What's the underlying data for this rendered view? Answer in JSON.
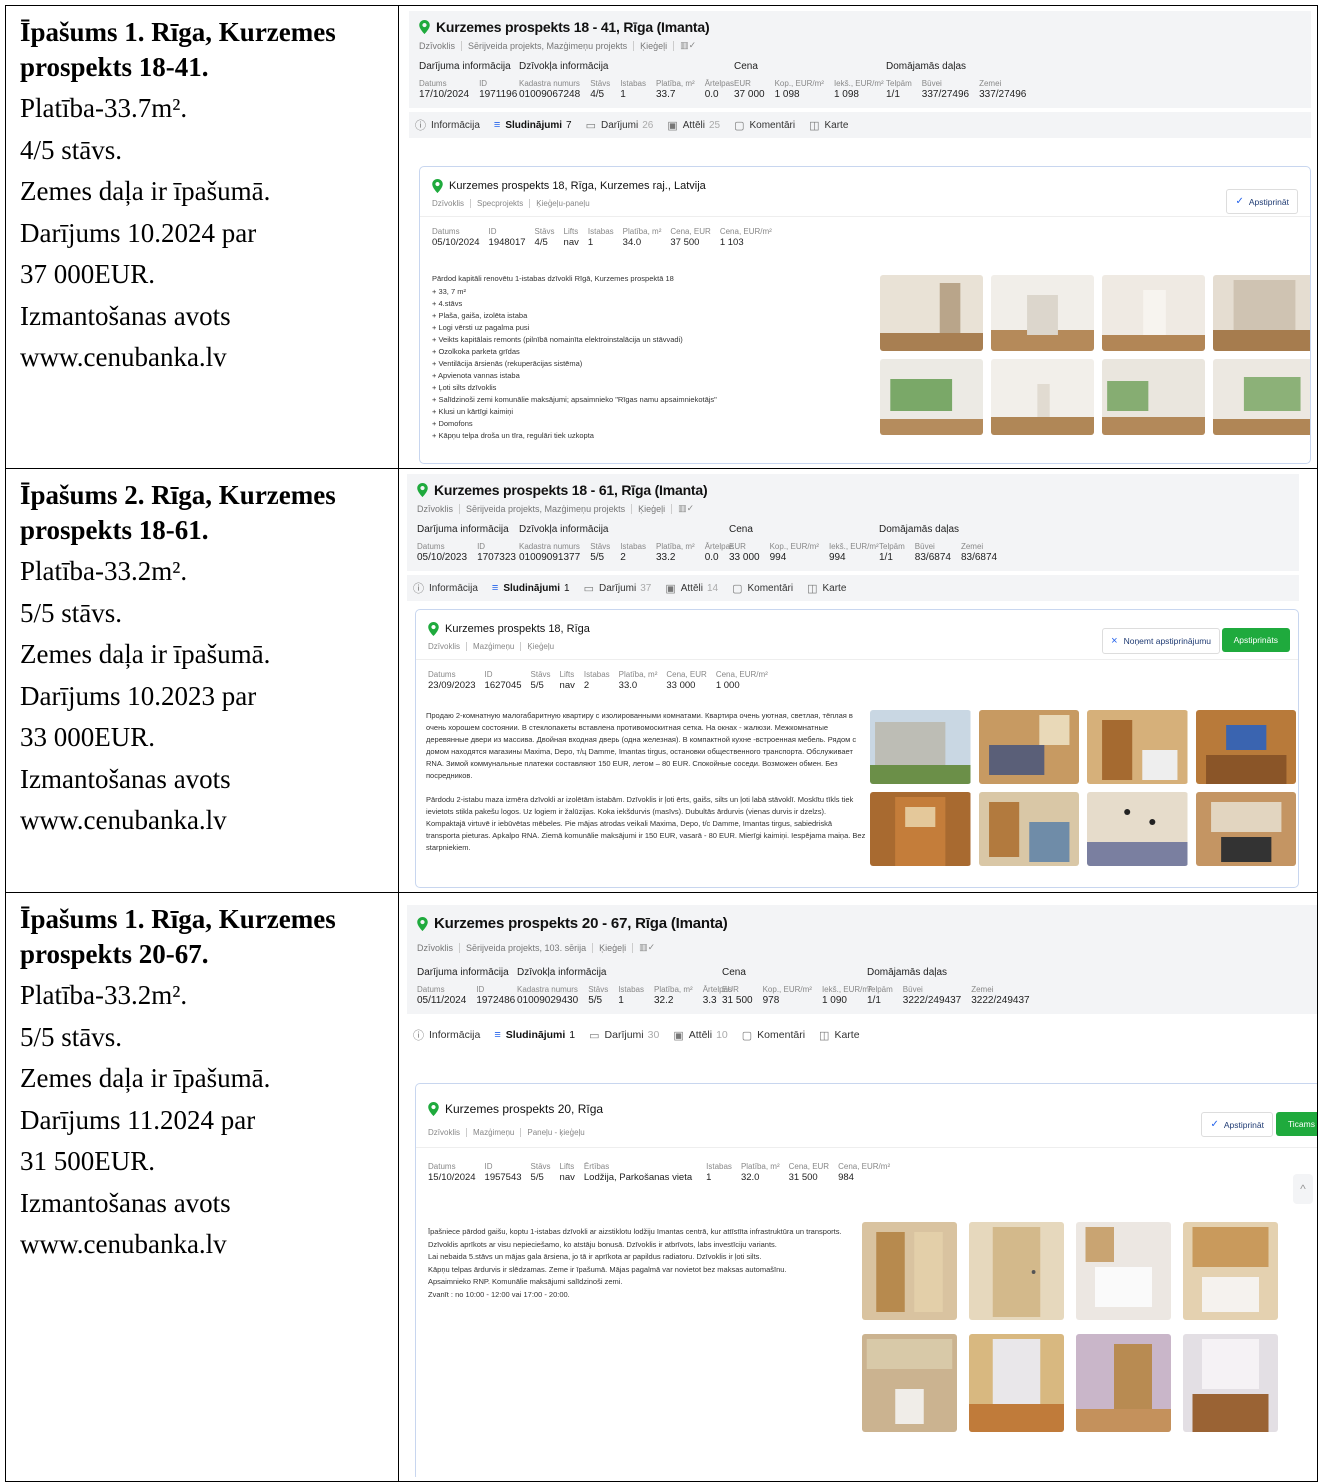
{
  "rows": [
    {
      "left": {
        "title": "Īpašums 1. Rīga, Kurzemes prospekts 18-41.",
        "title_line1": "Īpašums 1. Rīga, Kurzemes",
        "title_line2": "prospekts 18-41.",
        "area": "Platība-33.7m².",
        "floor": "4/5 stāvs.",
        "land": "Zemes daļa ir īpašumā.",
        "deal_line1": "Darījums 10.2024 par",
        "deal_line2": "37 000EUR.",
        "source_line1": "Izmantošanas avots",
        "source_line2": "www.cenubanka.lv"
      },
      "shot": {
        "address": "Kurzemes prospekts 18 - 41, Rīga (Imanta)",
        "tags": [
          "Dzīvoklis",
          "Sērijveida projekts, Mazģimeņu projekts",
          "Ķieģeļi",
          "▥✓"
        ],
        "groups": [
          {
            "title": "Darījuma informācija",
            "fields": [
              {
                "k": "Datums",
                "v": "17/10/2024"
              },
              {
                "k": "ID",
                "v": "1971196"
              }
            ]
          },
          {
            "title": "Dzīvokļa informācija",
            "fields": [
              {
                "k": "Kadastra numurs",
                "v": "01009067248"
              },
              {
                "k": "Stāvs",
                "v": "4/5"
              },
              {
                "k": "Istabas",
                "v": "1"
              },
              {
                "k": "Platība, m²",
                "v": "33.7"
              },
              {
                "k": "Ārtelpas",
                "v": "0.0"
              }
            ]
          },
          {
            "title": "Cena",
            "fields": [
              {
                "k": "EUR",
                "v": "37 000"
              },
              {
                "k": "Kop., EUR/m²",
                "v": "1 098"
              },
              {
                "k": "Iekš., EUR/m²",
                "v": "1 098"
              }
            ]
          },
          {
            "title": "Domājamās daļas",
            "fields": [
              {
                "k": "Telpām",
                "v": "1/1"
              },
              {
                "k": "Būvei",
                "v": "337/27496"
              },
              {
                "k": "Zemei",
                "v": "337/27496"
              }
            ]
          }
        ],
        "tabs": [
          {
            "icon": "ⓘ",
            "label": "Informācija",
            "count": ""
          },
          {
            "icon": "≡",
            "label": "Sludinājumi",
            "count": "7"
          },
          {
            "icon": "▭",
            "label": "Darījumi",
            "count": "26"
          },
          {
            "icon": "▣",
            "label": "Attēli",
            "count": "25"
          },
          {
            "icon": "▢",
            "label": "Komentāri",
            "count": ""
          },
          {
            "icon": "◫",
            "label": "Karte",
            "count": ""
          }
        ],
        "card": {
          "address": "Kurzemes prospekts 18, Rīga, Kurzemes raj., Latvija",
          "tags": [
            "Dzīvoklis",
            "Specprojekts",
            "Ķieģeļu-paneļu"
          ],
          "fields": [
            {
              "k": "Datums",
              "v": "05/10/2024"
            },
            {
              "k": "ID",
              "v": "1948017"
            },
            {
              "k": "Stāvs",
              "v": "4/5"
            },
            {
              "k": "Lifts",
              "v": "nav"
            },
            {
              "k": "Istabas",
              "v": "1"
            },
            {
              "k": "Platība, m²",
              "v": "34.0"
            },
            {
              "k": "Cena, EUR",
              "v": "37 500"
            },
            {
              "k": "Cena, EUR/m²",
              "v": "1 103"
            }
          ],
          "confirm": "Apstiprināt",
          "desc": [
            "Pārdod kapitāli renovētu 1-istabas dzīvokli Rīgā, Kurzemes prospektā 18",
            "+ 33, 7 m²",
            "+ 4.stāvs",
            "+ Plaša, gaiša, izolēta istaba",
            "+ Logi vērsti uz pagalma pusi",
            "+ Veikts kapitālais remonts (pilnībā nomainīta elektroinstalācija un stāvvadi)",
            "+ Ozolkoka parketa grīdas",
            "+ Ventilācija ārsienās (rekuperācijas sistēma)",
            "+ Apvienota vannas istaba",
            "+ Ļoti silts dzīvoklis",
            "+ Salīdzinoši zemi komunālie maksājumi; apsaimnieko \"Rīgas namu apsaimniekotājs\"",
            "+ Klusi un kārtīgi kaimiņi",
            "+ Domofons",
            "+ Kāpņu telpa droša un tīra, regulāri tiek uzkopta"
          ]
        }
      }
    },
    {
      "left": {
        "title_line1": "Īpašums 2. Rīga, Kurzemes",
        "title_line2": "prospekts 18-61.",
        "area": "Platība-33.2m².",
        "floor": "5/5 stāvs.",
        "land": "Zemes daļa ir īpašumā.",
        "deal_line1": "Darījums 10.2023 par",
        "deal_line2": "33 000EUR.",
        "source_line1": "Izmantošanas avots",
        "source_line2": "www.cenubanka.lv"
      },
      "shot": {
        "address": "Kurzemes prospekts 18 - 61, Rīga (Imanta)",
        "tags": [
          "Dzīvoklis",
          "Sērijveida projekts, Mazģimeņu projekts",
          "Ķieģeļi",
          "▥✓"
        ],
        "groups": [
          {
            "title": "Darījuma informācija",
            "fields": [
              {
                "k": "Datums",
                "v": "05/10/2023"
              },
              {
                "k": "ID",
                "v": "1707323"
              }
            ]
          },
          {
            "title": "Dzīvokļa informācija",
            "fields": [
              {
                "k": "Kadastra numurs",
                "v": "01009091377"
              },
              {
                "k": "Stāvs",
                "v": "5/5"
              },
              {
                "k": "Istabas",
                "v": "2"
              },
              {
                "k": "Platība, m²",
                "v": "33.2"
              },
              {
                "k": "Ārtelpas",
                "v": "0.0"
              }
            ]
          },
          {
            "title": "Cena",
            "fields": [
              {
                "k": "EUR",
                "v": "33 000"
              },
              {
                "k": "Kop., EUR/m²",
                "v": "994"
              },
              {
                "k": "Iekš., EUR/m²",
                "v": "994"
              }
            ]
          },
          {
            "title": "Domājamās daļas",
            "fields": [
              {
                "k": "Telpām",
                "v": "1/1"
              },
              {
                "k": "Būvei",
                "v": "83/6874"
              },
              {
                "k": "Zemei",
                "v": "83/6874"
              }
            ]
          }
        ],
        "tabs": [
          {
            "icon": "ⓘ",
            "label": "Informācija",
            "count": ""
          },
          {
            "icon": "≡",
            "label": "Sludinājumi",
            "count": "1"
          },
          {
            "icon": "▭",
            "label": "Darījumi",
            "count": "37"
          },
          {
            "icon": "▣",
            "label": "Attēli",
            "count": "14"
          },
          {
            "icon": "▢",
            "label": "Komentāri",
            "count": ""
          },
          {
            "icon": "◫",
            "label": "Karte",
            "count": ""
          }
        ],
        "card": {
          "address": "Kurzemes prospekts 18, Rīga",
          "tags": [
            "Dzīvoklis",
            "Mazģimeņu",
            "Ķieģeļu"
          ],
          "fields": [
            {
              "k": "Datums",
              "v": "23/09/2023"
            },
            {
              "k": "ID",
              "v": "1627045"
            },
            {
              "k": "Stāvs",
              "v": "5/5"
            },
            {
              "k": "Lifts",
              "v": "nav"
            },
            {
              "k": "Istabas",
              "v": "2"
            },
            {
              "k": "Platība, m²",
              "v": "33.0"
            },
            {
              "k": "Cena, EUR",
              "v": "33 000"
            },
            {
              "k": "Cena, EUR/m²",
              "v": "1 000"
            }
          ],
          "unconfirm": "Noņemt apstiprinājumu",
          "confirmed": "Apstiprināts",
          "desc_p1": "Продаю 2-комнатную малогабаритную квартиру с изолированными комнатами. Квартира очень уютная, светлая, тёплая в очень хорошем состоянии. В стеклопакеты вставлена противомоскитная сетка. На окнах - жалюзи. Межкомнатные деревянные двери из массива. Двойная входная дверь (одна железная). В компактной кухне -встроенная мебель. Рядом с домом находятся магазины Maxima, Depo, т/ц Damme, Imantas tirgus, остановки общественного транспорта. Обслуживает RNA. Зимой коммунальные платежи составляют 150 EUR, летом – 80 EUR. Спокойные соседи. Возможен обмен. Без посредников.",
          "desc_p2": "Pārdodu 2-istabu maza izmēra dzīvokli ar izolētām istabām. Dzīvoklis ir ļoti ērts, gaišs, silts un ļoti labā stāvoklī. Moskītu tīkls tiek ievietots stikla pakešu logos. Uz logiem ir žalūzijas. Koka iekšdurvis (masīvs). Dubultās ārdurvis (vienas durvis ir dzelzs). Kompaktajā virtuvē ir iebūvētas mēbeles. Pie mājas atrodas veikali Maxima, Depo, t/c Damme, Imantas tirgus, sabiedriskā transporta pieturas. Apkalpo RNA. Ziemā komunālie maksājumi ir 150 EUR, vasarā - 80 EUR. Mierīgi kaimiņi. Iespējama maiņa. Bez starpniekiem."
        }
      }
    },
    {
      "left": {
        "title_line1": "Īpašums 1. Rīga, Kurzemes",
        "title_line2": "prospekts 20-67.",
        "area": "Platība-33.2m².",
        "floor": "5/5 stāvs.",
        "land": "Zemes daļa ir īpašumā.",
        "deal_line1": "Darījums 11.2024 par",
        "deal_line2": "31 500EUR.",
        "source_line1": "Izmantošanas avots",
        "source_line2": "www.cenubanka.lv"
      },
      "shot": {
        "address": "Kurzemes prospekts 20 - 67, Rīga (Imanta)",
        "tags": [
          "Dzīvoklis",
          "Sērijveida projekts, 103. sērija",
          "Ķieģeļi",
          "▥✓"
        ],
        "groups": [
          {
            "title": "Darījuma informācija",
            "fields": [
              {
                "k": "Datums",
                "v": "05/11/2024"
              },
              {
                "k": "ID",
                "v": "1972486"
              }
            ]
          },
          {
            "title": "Dzīvokļa informācija",
            "fields": [
              {
                "k": "Kadastra numurs",
                "v": "01009029430"
              },
              {
                "k": "Stāvs",
                "v": "5/5"
              },
              {
                "k": "Istabas",
                "v": "1"
              },
              {
                "k": "Platība, m²",
                "v": "32.2"
              },
              {
                "k": "Ārtelpas",
                "v": "3.3"
              }
            ]
          },
          {
            "title": "Cena",
            "fields": [
              {
                "k": "EUR",
                "v": "31 500"
              },
              {
                "k": "Kop., EUR/m²",
                "v": "978"
              },
              {
                "k": "Iekš., EUR/m²",
                "v": "1 090"
              }
            ]
          },
          {
            "title": "Domājamās daļas",
            "fields": [
              {
                "k": "Telpām",
                "v": "1/1"
              },
              {
                "k": "Būvei",
                "v": "3222/249437"
              },
              {
                "k": "Zemei",
                "v": "3222/249437"
              }
            ]
          }
        ],
        "tabs": [
          {
            "icon": "ⓘ",
            "label": "Informācija",
            "count": ""
          },
          {
            "icon": "≡",
            "label": "Sludinājumi",
            "count": "1"
          },
          {
            "icon": "▭",
            "label": "Darījumi",
            "count": "30"
          },
          {
            "icon": "▣",
            "label": "Attēli",
            "count": "10"
          },
          {
            "icon": "▢",
            "label": "Komentāri",
            "count": ""
          },
          {
            "icon": "◫",
            "label": "Karte",
            "count": ""
          }
        ],
        "card": {
          "address": "Kurzemes prospekts 20, Rīga",
          "tags": [
            "Dzīvoklis",
            "Mazģimeņu",
            "Paneļu - ķieģeļu"
          ],
          "fields": [
            {
              "k": "Datums",
              "v": "15/10/2024"
            },
            {
              "k": "ID",
              "v": "1957543"
            },
            {
              "k": "Stāvs",
              "v": "5/5"
            },
            {
              "k": "Lifts",
              "v": "nav"
            },
            {
              "k": "Ērtības",
              "v": "Lodžija, Parkošanas vieta"
            },
            {
              "k": "Istabas",
              "v": "1"
            },
            {
              "k": "Platība, m²",
              "v": "32.0"
            },
            {
              "k": "Cena, EUR",
              "v": "31 500"
            },
            {
              "k": "Cena, EUR/m²",
              "v": "984"
            }
          ],
          "confirm": "Apstiprināt",
          "trusted": "Ticams",
          "desc": [
            "Īpašniece pārdod gaišu, koptu 1-istabas dzīvokli ar aizstiklotu lodžiju Imantas centrā, kur attīstīta infrastruktūra un transports.",
            "Dzīvoklis aprīkots ar visu nepieciešamo, ko atstāju bonusā. Dzīvoklis ir atbrīvots, labs investīciju variants.",
            "Lai nebaida 5.stāvs un mājas gala ārsiena, jo tā ir aprīkota ar papildus radiatoru. Dzīvoklis ir ļoti silts.",
            "Kāpņu telpas ārdurvis ir slēdzamas. Zeme ir īpašumā. Mājas pagalmā var novietot bez maksas automašīnu.",
            "Apsaimnieko RNP. Komunālie maksājumi salīdzinoši zemi.",
            "Zvanīt : no 10:00 - 12:00 vai 17:00 - 20:00."
          ]
        }
      }
    }
  ],
  "colors": {
    "accent_blue": "#2563eb",
    "pin_green": "#1faa3d",
    "header_bg": "#f3f4f6",
    "card_border": "#c8d6ef"
  },
  "icons": {
    "pin": "map-pin-icon",
    "check": "check-icon",
    "close": "close-icon",
    "chevron_up": "chevron-up-icon"
  }
}
